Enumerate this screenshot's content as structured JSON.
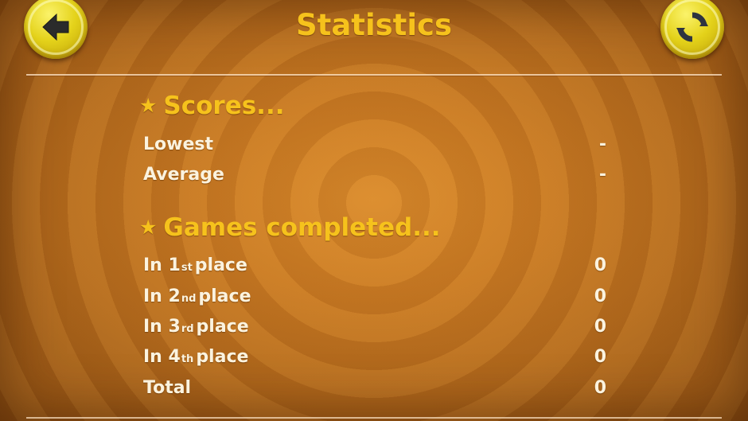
{
  "header": {
    "title": "Statistics",
    "back_icon": "back-arrow-icon",
    "refresh_icon": "refresh-icon"
  },
  "colors": {
    "title": "#f6c21c",
    "text": "#fbf3df",
    "button": "#e4d21a",
    "background": "#c97a23"
  },
  "scores": {
    "heading_star": "★",
    "heading": "Scores...",
    "rows": [
      {
        "label": "Lowest",
        "value": "-"
      },
      {
        "label": "Average",
        "value": "-"
      }
    ]
  },
  "games": {
    "heading_star": "★",
    "heading": "Games completed...",
    "rows": [
      {
        "prefix": "In 1",
        "suffix": "st",
        "rest": "place",
        "value": "0"
      },
      {
        "prefix": "In 2",
        "suffix": "nd",
        "rest": "place",
        "value": "0"
      },
      {
        "prefix": "In 3",
        "suffix": "rd",
        "rest": "place",
        "value": "0"
      },
      {
        "prefix": "In 4",
        "suffix": "th",
        "rest": "place",
        "value": "0"
      }
    ],
    "total": {
      "label": "Total",
      "value": "0"
    }
  }
}
